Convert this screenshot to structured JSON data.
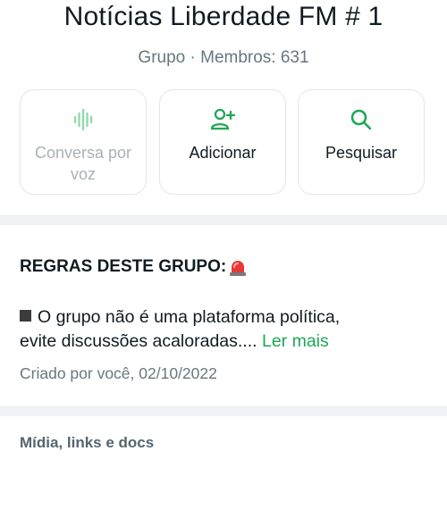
{
  "group": {
    "name": "Notícias Liberdade FM # 1",
    "subtitle": "Grupo · Membros: 631"
  },
  "actions": [
    {
      "label": "Conversa por voz",
      "icon": "voice-wave-icon",
      "enabled": false
    },
    {
      "label": "Adicionar",
      "icon": "add-person-icon",
      "enabled": true
    },
    {
      "label": "Pesquisar",
      "icon": "search-icon",
      "enabled": true
    }
  ],
  "description": {
    "title": "REGRAS DESTE GRUPO:",
    "title_icon": "siren-icon",
    "text_line1": "O grupo não é uma plataforma política,",
    "text_line2": "evite discussões acaloradas....",
    "read_more": "Ler mais",
    "created": "Criado por você, 02/10/2022"
  },
  "media_section": {
    "title": "Mídia, links e docs"
  },
  "colors": {
    "accent": "#1fa855",
    "muted_text": "#667781",
    "disabled_icon": "#93d8b0"
  }
}
